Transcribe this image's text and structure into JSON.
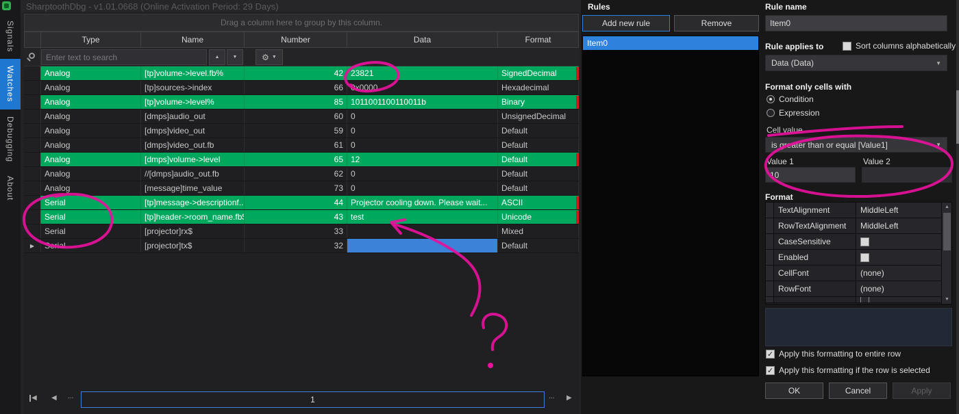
{
  "window": {
    "title": "SharptoothDbg - v1.01.0668 (Online Activation Period: 29 Days)"
  },
  "sidebar": {
    "items": [
      {
        "label": "Signals",
        "active": false
      },
      {
        "label": "Watches",
        "active": true
      },
      {
        "label": "Debugging",
        "active": false
      },
      {
        "label": "About",
        "active": false
      }
    ]
  },
  "grid": {
    "group_hint": "Drag a column here to group by this column.",
    "columns": [
      "Type",
      "Name",
      "Number",
      "Data",
      "Format"
    ],
    "search": {
      "placeholder": "Enter text to search"
    },
    "rows": [
      {
        "type": "Analog",
        "name": "[tp]volume->level.fb%",
        "number": "42",
        "data": "23821",
        "format": "SignedDecimal",
        "green": true
      },
      {
        "type": "Analog",
        "name": "[tp]sources->index",
        "number": "66",
        "data": "0x0000",
        "format": "Hexadecimal"
      },
      {
        "type": "Analog",
        "name": "[tp]volume->level%",
        "number": "85",
        "data": "1011001100110011b",
        "format": "Binary",
        "green": true
      },
      {
        "type": "Analog",
        "name": "[dmps]audio_out",
        "number": "60",
        "data": "0",
        "format": "UnsignedDecimal"
      },
      {
        "type": "Analog",
        "name": "[dmps]video_out",
        "number": "59",
        "data": "0",
        "format": "Default"
      },
      {
        "type": "Analog",
        "name": "[dmps]video_out.fb",
        "number": "61",
        "data": "0",
        "format": "Default"
      },
      {
        "type": "Analog",
        "name": "[dmps]volume->level",
        "number": "65",
        "data": "12",
        "format": "Default",
        "green": true
      },
      {
        "type": "Analog",
        "name": "//[dmps]audio_out.fb",
        "number": "62",
        "data": "0",
        "format": "Default"
      },
      {
        "type": "Analog",
        "name": "[message]time_value",
        "number": "73",
        "data": "0",
        "format": "Default"
      },
      {
        "type": "Serial",
        "name": "[tp]message->descriptionf...",
        "number": "44",
        "data": "Projector cooling down. Please wait...",
        "format": "ASCII",
        "green": true
      },
      {
        "type": "Serial",
        "name": "[tp]header->room_name.fb$",
        "number": "43",
        "data": "test",
        "format": "Unicode",
        "green": true
      },
      {
        "type": "Serial",
        "name": "[projector]rx$",
        "number": "33",
        "data": "",
        "format": "Mixed"
      },
      {
        "type": "Serial",
        "name": "[projector]tx$",
        "number": "32",
        "data": "",
        "format": "Default",
        "expander": true,
        "selected_data": true
      }
    ],
    "pager": {
      "current_page": "1",
      "ellipsis": "..."
    }
  },
  "rules_panel": {
    "rules_label": "Rules",
    "add_button": "Add new rule",
    "remove_button": "Remove",
    "items": [
      {
        "label": "Item0",
        "selected": true
      }
    ],
    "rule_name_label": "Rule name",
    "rule_name_value": "Item0",
    "applies_label": "Rule applies to",
    "sort_checkbox_label": "Sort columns alphabetically",
    "applies_value": "Data (Data)",
    "format_cells_label": "Format only cells with",
    "condition_label": "Condition",
    "expression_label": "Expression",
    "cell_value_label": "Cell value",
    "condition_value": "is greater than or equal [Value1]",
    "value1_label": "Value 1",
    "value2_label": "Value 2",
    "value1": "10",
    "value2": "",
    "format_label": "Format",
    "properties": [
      {
        "name": "TextAlignment",
        "display": "MiddleLeft"
      },
      {
        "name": "RowTextAlignment",
        "display": "MiddleLeft"
      },
      {
        "name": "CaseSensitive",
        "display": "",
        "checkbox": true,
        "checked": false
      },
      {
        "name": "Enabled",
        "display": "",
        "checkbox": true,
        "checked": true
      },
      {
        "name": "CellFont",
        "display": "(none)"
      },
      {
        "name": "RowFont",
        "display": "(none)"
      }
    ],
    "apply_row_label": "Apply this formatting to entire row",
    "apply_selected_label": "Apply this formatting if the row is selected",
    "ok_button": "OK",
    "cancel_button": "Cancel",
    "apply_button": "Apply"
  },
  "colors": {
    "highlight_green": "#00a85e",
    "selection_blue": "#2d82dd",
    "annotation_pink": "#e7119c",
    "row_flag_red": "#d11a1a"
  },
  "annotations": {
    "items": [
      "circle-around-23821",
      "circle-around-serial-rows",
      "arrow-to-test-cell",
      "question-mark",
      "strike-through-cell-value",
      "circle-around-value-inputs"
    ]
  }
}
